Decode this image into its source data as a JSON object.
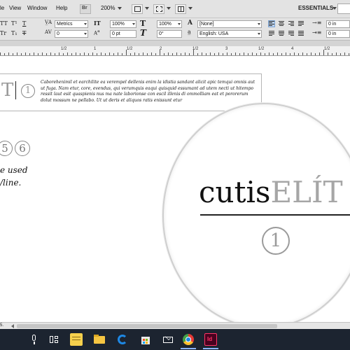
{
  "menubar": {
    "items": [
      "le",
      "View",
      "Window",
      "Help"
    ],
    "bridge_label": "Br",
    "zoom": "200%",
    "workspace": "ESSENTIALS"
  },
  "control": {
    "row1": {
      "type_icons": [
        "TT",
        "T¹",
        "T"
      ],
      "kerning_label": "Metrics",
      "h_scale": "100%",
      "v_scale_label": "T",
      "v_scale": "100%",
      "char_style": "[None]",
      "indent_value": "0 in"
    },
    "row2": {
      "type_icons": [
        "Tr",
        "T₁",
        "T"
      ],
      "tracking": "0",
      "baseline": "0 pt",
      "skew_label": "T",
      "skew": "0°",
      "language": "English: USA",
      "indent_value": "0 in"
    }
  },
  "ruler": {
    "labels": [
      "1/2",
      "1",
      "1/2",
      "2",
      "1/2",
      "3",
      "1/2",
      "4",
      "1/2"
    ]
  },
  "document": {
    "frame_logo": "T",
    "frame_circle_num": "1",
    "paragraph": "Caborehenimil et earchilite ea verempel dellenis enim la idistia sandant alicit apic temqui omnis aut ut fuga. Nam etur, core, evendus, qui verumquis eaqui quisquid essumant ad utem necti ut hitempo ressit laut esit quaspienis nus ma nate laborionse con escil illenis di ommolliam eat et pororerum dolut mossum ne pellabo. Ut ut deris et aliquos ratis enissunt etur",
    "circle_numbers": [
      "5",
      "6"
    ],
    "used_line1": "e used",
    "used_line2": "/line."
  },
  "magnifier": {
    "brand_dark": "cutis",
    "brand_light": "ELÍT",
    "circle_num": "1"
  },
  "statusbar": {
    "zoom_field": "5."
  },
  "taskbar": {
    "apps": [
      "microphone-icon",
      "task-view-icon",
      "sticky-notes-icon",
      "file-explorer-icon",
      "edge-icon",
      "store-icon",
      "mail-icon",
      "chrome-icon",
      "indesign-icon"
    ],
    "indesign_label": "Id",
    "colors": {
      "taskbar_bg": "#1c2430",
      "indesign": "#49021f",
      "indesign_text": "#ff3366",
      "folder": "#f5c542",
      "edge": "#1e88e5",
      "chrome_red": "#e53935",
      "chrome_green": "#43a047",
      "chrome_yellow": "#fbc02d"
    }
  }
}
